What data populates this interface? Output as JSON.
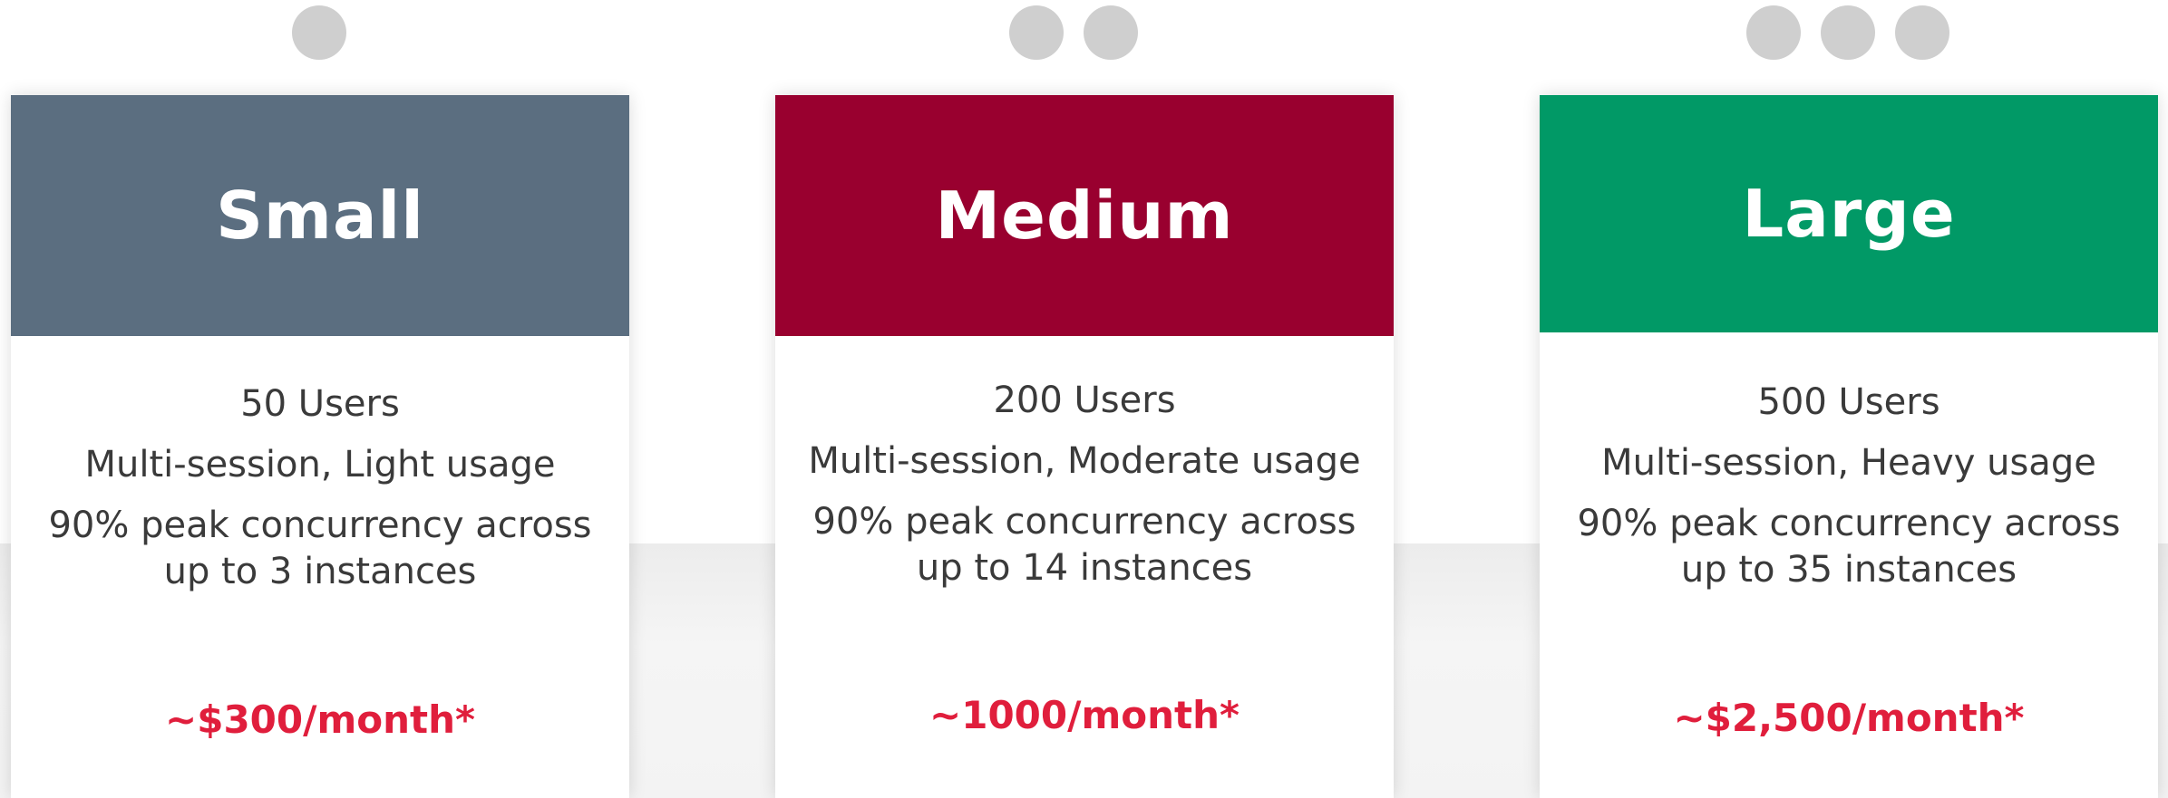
{
  "colors": {
    "small": "#5b6e80",
    "medium": "#99002f",
    "large": "#019966",
    "price": "#e01e3c",
    "dot": "#cfcfcf"
  },
  "plans": [
    {
      "dot_count": 1,
      "title": "Small",
      "users": "50 Users",
      "usage": "Multi-session, Light usage",
      "concurrency": "90% peak concurrency across up to 3 instances",
      "price": "~$300/month*"
    },
    {
      "dot_count": 2,
      "title": "Medium",
      "users": "200 Users",
      "usage": "Multi-session, Moderate usage",
      "concurrency": "90% peak concurrency across up to 14 instances",
      "price": "~1000/month*"
    },
    {
      "dot_count": 3,
      "title": "Large",
      "users": "500 Users",
      "usage": "Multi-session, Heavy usage",
      "concurrency": "90% peak concurrency across up to 35 instances",
      "price": "~$2,500/month*"
    }
  ]
}
